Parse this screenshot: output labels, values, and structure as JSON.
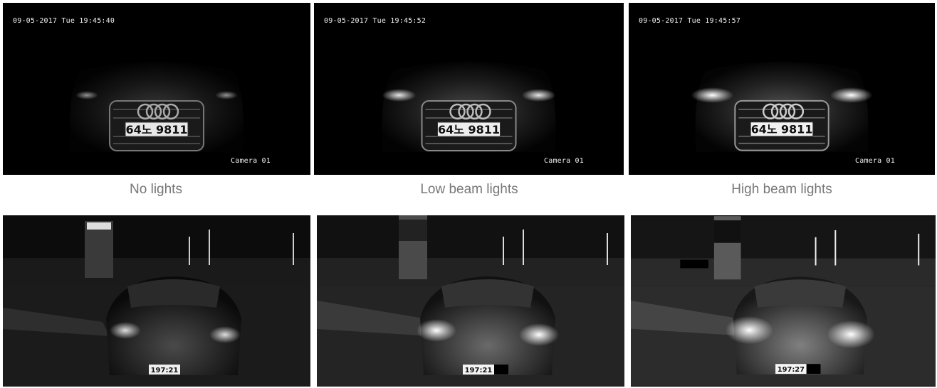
{
  "top_row": [
    {
      "timestamp": "09-05-2017 Tue 19:45:40",
      "camera": "Camera 01",
      "plate": "64노 9811",
      "caption": "No lights",
      "headlight_level": 0.25
    },
    {
      "timestamp": "09-05-2017 Tue 19:45:52",
      "camera": "Camera 01",
      "plate": "64노 9811",
      "caption": "Low beam lights",
      "headlight_level": 0.6
    },
    {
      "timestamp": "09-05-2017 Tue 19:45:57",
      "camera": "Camera 01",
      "plate": "64노 9811",
      "caption": "High beam lights",
      "headlight_level": 0.9
    }
  ],
  "bottom_row": [
    {
      "plate": "197:21",
      "headlight_level": 0.5
    },
    {
      "plate": "197:21",
      "headlight_level": 0.75
    },
    {
      "plate": "197:27",
      "headlight_level": 1.0
    }
  ],
  "colors": {
    "caption": "#777777",
    "osd_text": "#f0f0f0",
    "background": "#ffffff"
  }
}
